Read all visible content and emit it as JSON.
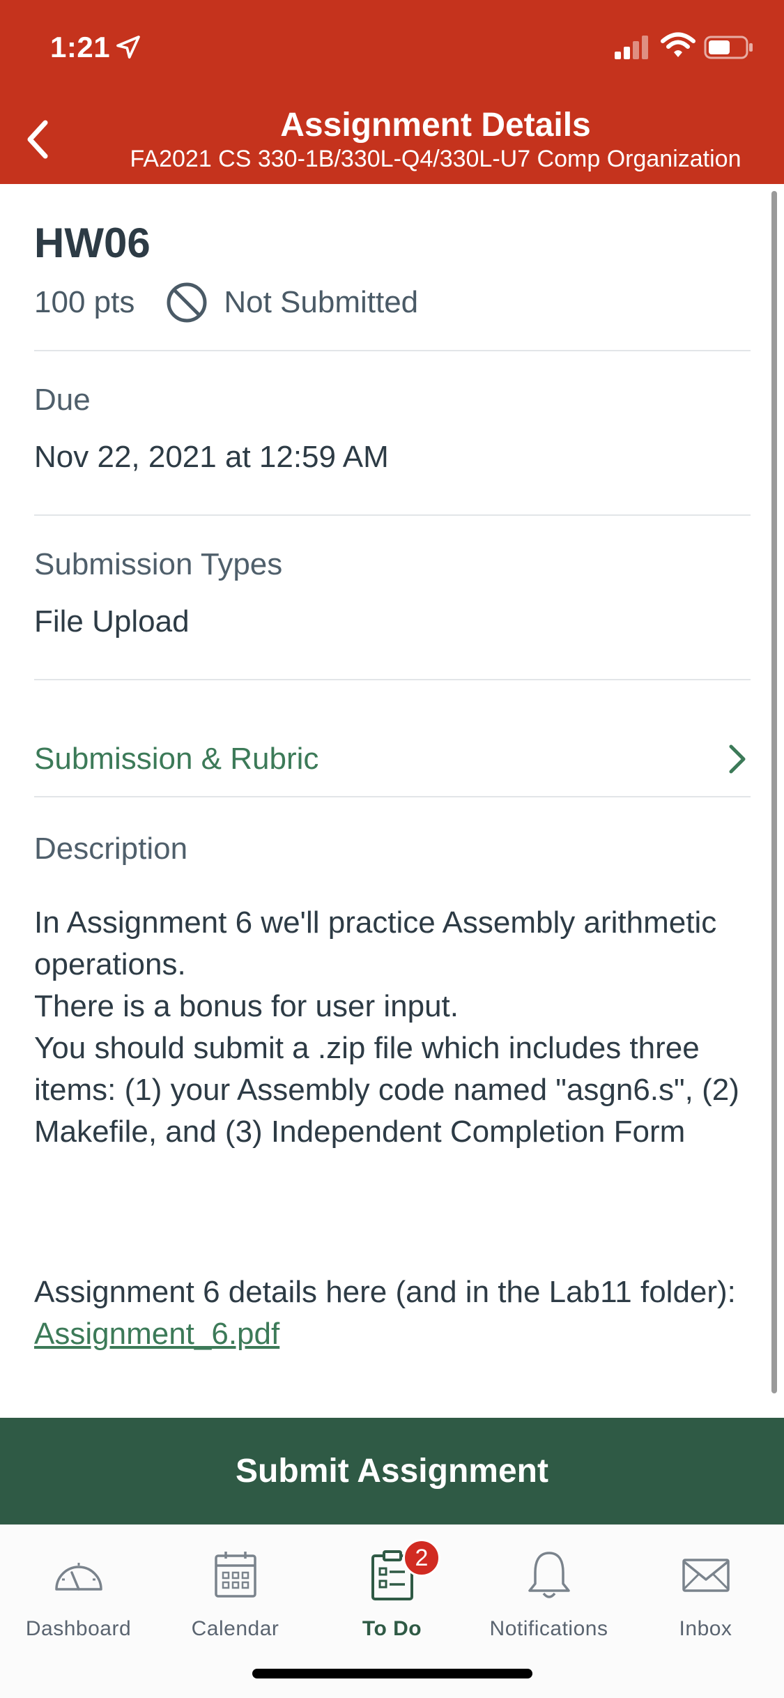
{
  "status_bar": {
    "time": "1:21"
  },
  "header": {
    "title": "Assignment Details",
    "subtitle": "FA2021 CS 330-1B/330L-Q4/330L-U7 Comp Organization"
  },
  "assignment": {
    "name": "HW06",
    "points": "100 pts",
    "status": "Not Submitted"
  },
  "due": {
    "label": "Due",
    "value": "Nov 22, 2021 at 12:59 AM"
  },
  "submission_types": {
    "label": "Submission Types",
    "value": "File Upload"
  },
  "rubric_link": {
    "label": "Submission & Rubric"
  },
  "description": {
    "label": "Description",
    "lines": [
      "In Assignment 6 we'll practice Assembly arithmetic operations.",
      "There is a bonus for user input.",
      "You should submit a .zip file which includes three items:  (1) your Assembly code named \"asgn6.s\", (2) Makefile, and (3) Independent Completion Form"
    ],
    "details_prefix": "Assignment 6 details here (and in the Lab11 folder): ",
    "details_link": "Assignment_6.pdf"
  },
  "submit_button": {
    "label": "Submit Assignment"
  },
  "tabbar": {
    "items": [
      {
        "label": "Dashboard",
        "icon": "dashboard-icon"
      },
      {
        "label": "Calendar",
        "icon": "calendar-icon"
      },
      {
        "label": "To Do",
        "icon": "todo-icon",
        "badge": "2"
      },
      {
        "label": "Notifications",
        "icon": "bell-icon"
      },
      {
        "label": "Inbox",
        "icon": "mail-icon"
      }
    ]
  },
  "colors": {
    "header": "#c5331d",
    "accent_green": "#3c7a58",
    "submit_button": "#2f5a45",
    "badge": "#d12b22"
  }
}
